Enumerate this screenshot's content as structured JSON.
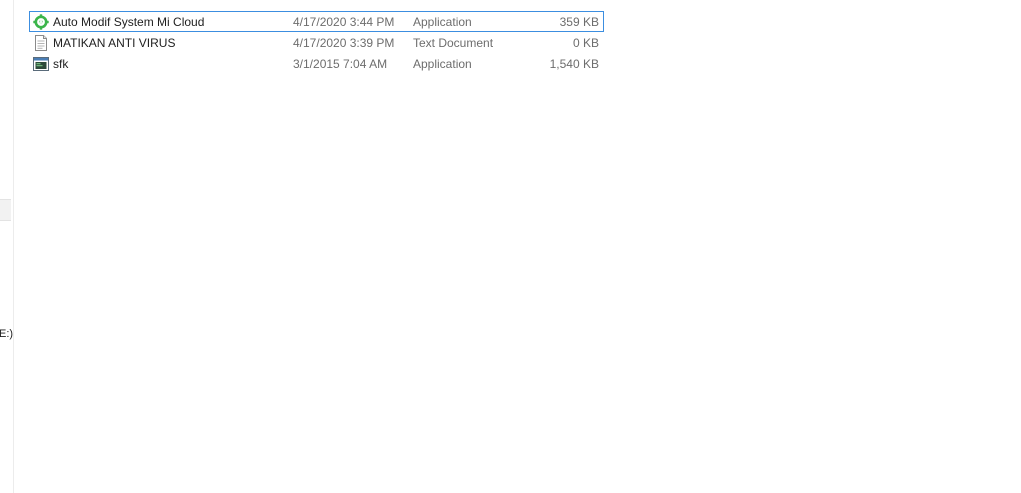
{
  "nav_pane": {
    "drive_label_fragment": "E:)"
  },
  "files": [
    {
      "name": "Auto Modif System Mi Cloud",
      "date_modified": "4/17/2020 3:44 PM",
      "type": "Application",
      "size": "359 KB",
      "icon": "green-gear-app-icon",
      "focused": true
    },
    {
      "name": "MATIKAN ANTI VIRUS",
      "date_modified": "4/17/2020 3:39 PM",
      "type": "Text Document",
      "size": "0 KB",
      "icon": "text-document-icon",
      "focused": false
    },
    {
      "name": "sfk",
      "date_modified": "3/1/2015 7:04 AM",
      "type": "Application",
      "size": "1,540 KB",
      "icon": "console-app-icon",
      "focused": false
    }
  ],
  "colors": {
    "focus_border": "#3c8ee0",
    "secondary_text": "#6d6d6d",
    "app_icon_green": "#3bb54a"
  }
}
